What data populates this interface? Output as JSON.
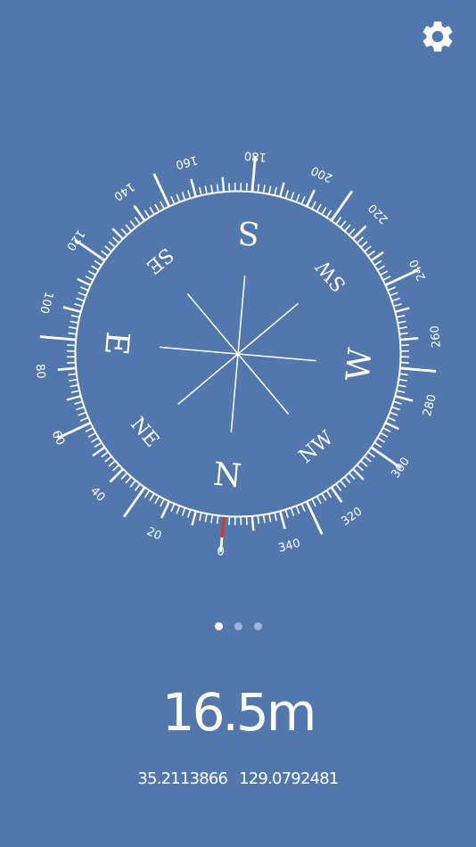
{
  "app": {
    "background_color": "#5277ad",
    "foreground_color": "#ffffff",
    "heading_marker_color": "#d6372c"
  },
  "settings": {
    "icon": "gear-icon"
  },
  "compass": {
    "heading_degrees": 355,
    "degree_labels": [
      "0",
      "20",
      "40",
      "60",
      "80",
      "100",
      "120",
      "140",
      "160",
      "180",
      "200",
      "220",
      "240",
      "260",
      "280",
      "300",
      "320",
      "340"
    ],
    "cardinal_labels": {
      "n": "N",
      "ne": "NE",
      "e": "E",
      "se": "SE",
      "s": "S",
      "sw": "SW",
      "w": "W",
      "nw": "NW"
    }
  },
  "pager": {
    "page_count": 3,
    "active_index": 0
  },
  "readouts": {
    "altitude": "16.5m",
    "latitude": "35.2113866",
    "longitude": "129.0792481"
  }
}
